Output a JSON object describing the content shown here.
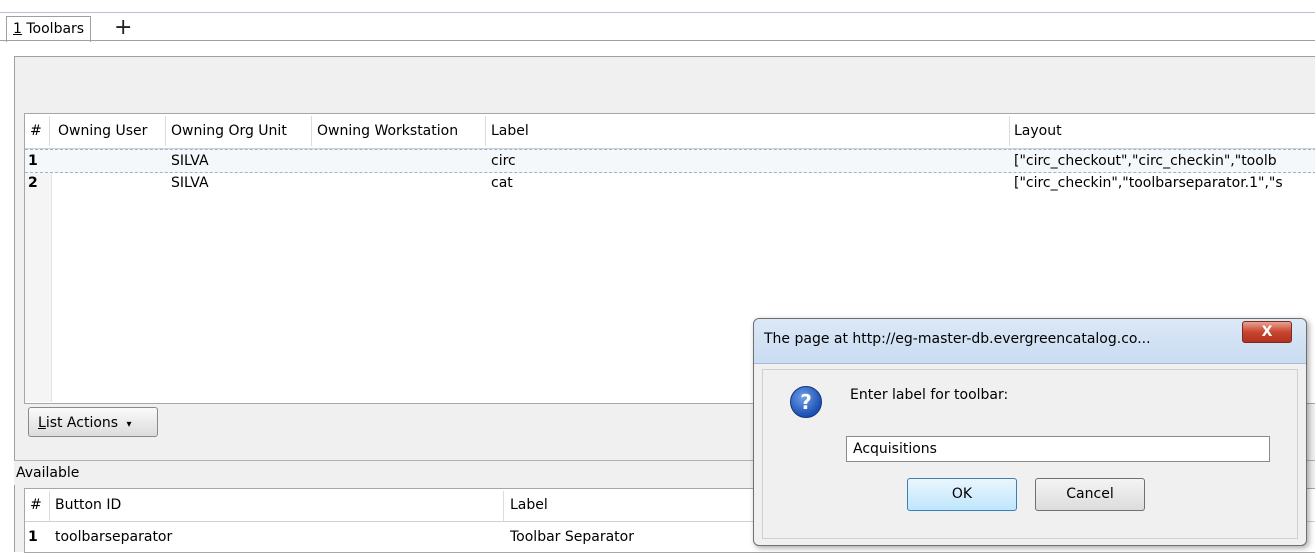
{
  "tabs": [
    {
      "label_prefix": "1",
      "label": " Toolbars"
    }
  ],
  "add_tab_glyph": "+",
  "grid": {
    "headers": [
      "#",
      "Owning User",
      "Owning Org Unit",
      "Owning Workstation",
      "Label",
      "Layout"
    ],
    "rows": [
      {
        "num": "1",
        "user": "",
        "org": "SILVA",
        "ws": "",
        "label": "circ",
        "layout": "[\"circ_checkout\",\"circ_checkin\",\"toolb"
      },
      {
        "num": "2",
        "user": "",
        "org": "SILVA",
        "ws": "",
        "label": "cat",
        "layout": "[\"circ_checkin\",\"toolbarseparator.1\",\"s"
      }
    ]
  },
  "list_actions": {
    "label_prefix": "L",
    "label": "ist Actions",
    "arrow": "▾"
  },
  "available": {
    "title": "Available",
    "headers": [
      "#",
      "Button ID",
      "Label"
    ],
    "rows": [
      {
        "num": "1",
        "id": "toolbarseparator",
        "label": "Toolbar Separator"
      }
    ]
  },
  "dialog": {
    "title": "The page at http://eg-master-db.evergreencatalog.co...",
    "close_glyph": "X",
    "prompt": "Enter label for toolbar:",
    "input_value": "Acquisitions",
    "ok": "OK",
    "cancel": "Cancel",
    "icon_glyph": "?"
  }
}
